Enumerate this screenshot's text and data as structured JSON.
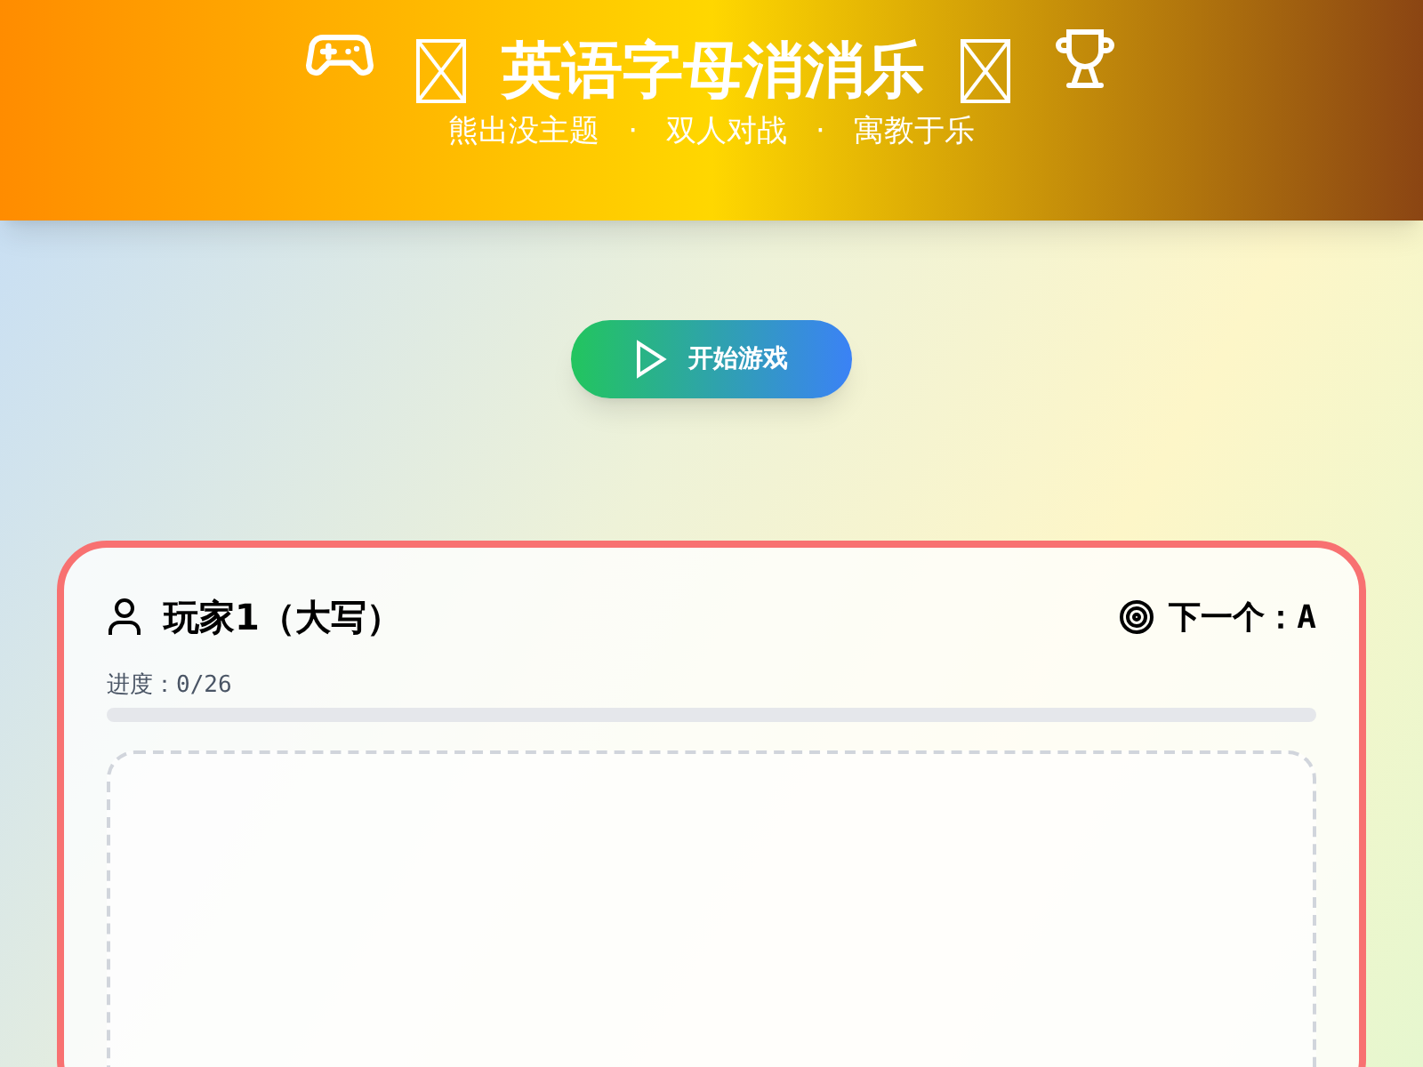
{
  "header": {
    "title": "英语字母消消乐",
    "subtitle": [
      "熊出没主题",
      "·",
      "双人对战",
      "·",
      "寓教于乐"
    ]
  },
  "start_button": {
    "label": "开始游戏"
  },
  "player_card": {
    "title": "玩家1（大写）",
    "next_label": "下一个：",
    "next_letter": "A",
    "progress_text": "进度：0/26",
    "progress": {
      "level": 0
    }
  }
}
